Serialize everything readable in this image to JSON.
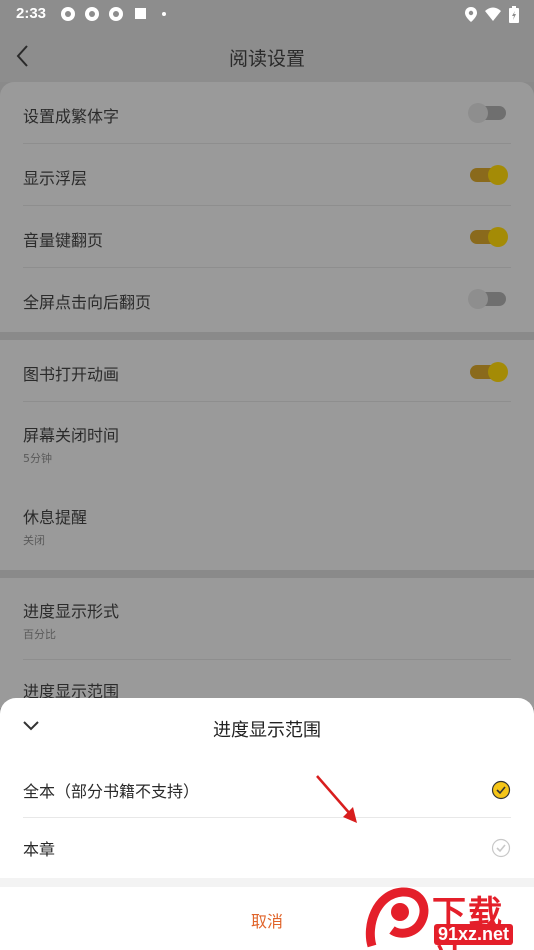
{
  "status_bar": {
    "time": "2:33"
  },
  "header": {
    "title": "阅读设置"
  },
  "group1": [
    {
      "label": "设置成繁体字",
      "toggle": "off"
    },
    {
      "label": "显示浮层",
      "toggle": "on"
    },
    {
      "label": "音量键翻页",
      "toggle": "on"
    },
    {
      "label": "全屏点击向后翻页",
      "toggle": "off"
    }
  ],
  "group2": [
    {
      "label": "图书打开动画",
      "toggle": "on"
    },
    {
      "label": "屏幕关闭时间",
      "sub": "5分钟"
    },
    {
      "label": "休息提醒",
      "sub": "关闭"
    }
  ],
  "group3": [
    {
      "label": "进度显示形式",
      "sub": "百分比"
    },
    {
      "label": "进度显示范围"
    }
  ],
  "sheet": {
    "title": "进度显示范围",
    "options": [
      {
        "label": "全本（部分书籍不支持）",
        "selected": true
      },
      {
        "label": "本章",
        "selected": false
      }
    ],
    "cancel": "取消"
  },
  "colors": {
    "accent": "#e0642a",
    "checked": "#f5c518",
    "toggle_on": "#a48b06"
  },
  "watermark": {
    "text": "下载站",
    "url": "91xz.net"
  }
}
